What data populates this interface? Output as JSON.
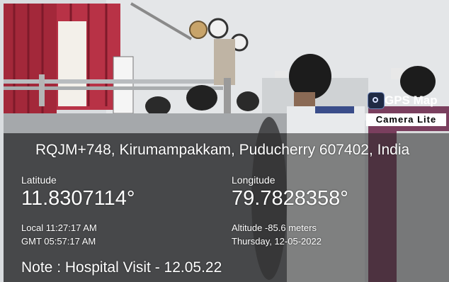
{
  "badge": {
    "title": "GPS Map",
    "subtitle": "Camera Lite",
    "icon": "gps-camera-icon"
  },
  "overlay": {
    "address": "RQJM+748, Kirumampakkam, Puducherry 607402, India",
    "latitude_label": "Latitude",
    "latitude_value": "11.8307114°",
    "longitude_label": "Longitude",
    "longitude_value": "79.7828358°",
    "local_time": "Local 11:27:17 AM",
    "gmt_time": "GMT 05:57:17 AM",
    "altitude": "Altitude -85.6 meters",
    "date": "Thursday, 12-05-2022",
    "note": "Note : Hospital Visit - 12.05.22"
  },
  "colors": {
    "overlay_text": "#ffffff",
    "badge_bg": "#ffffff"
  }
}
